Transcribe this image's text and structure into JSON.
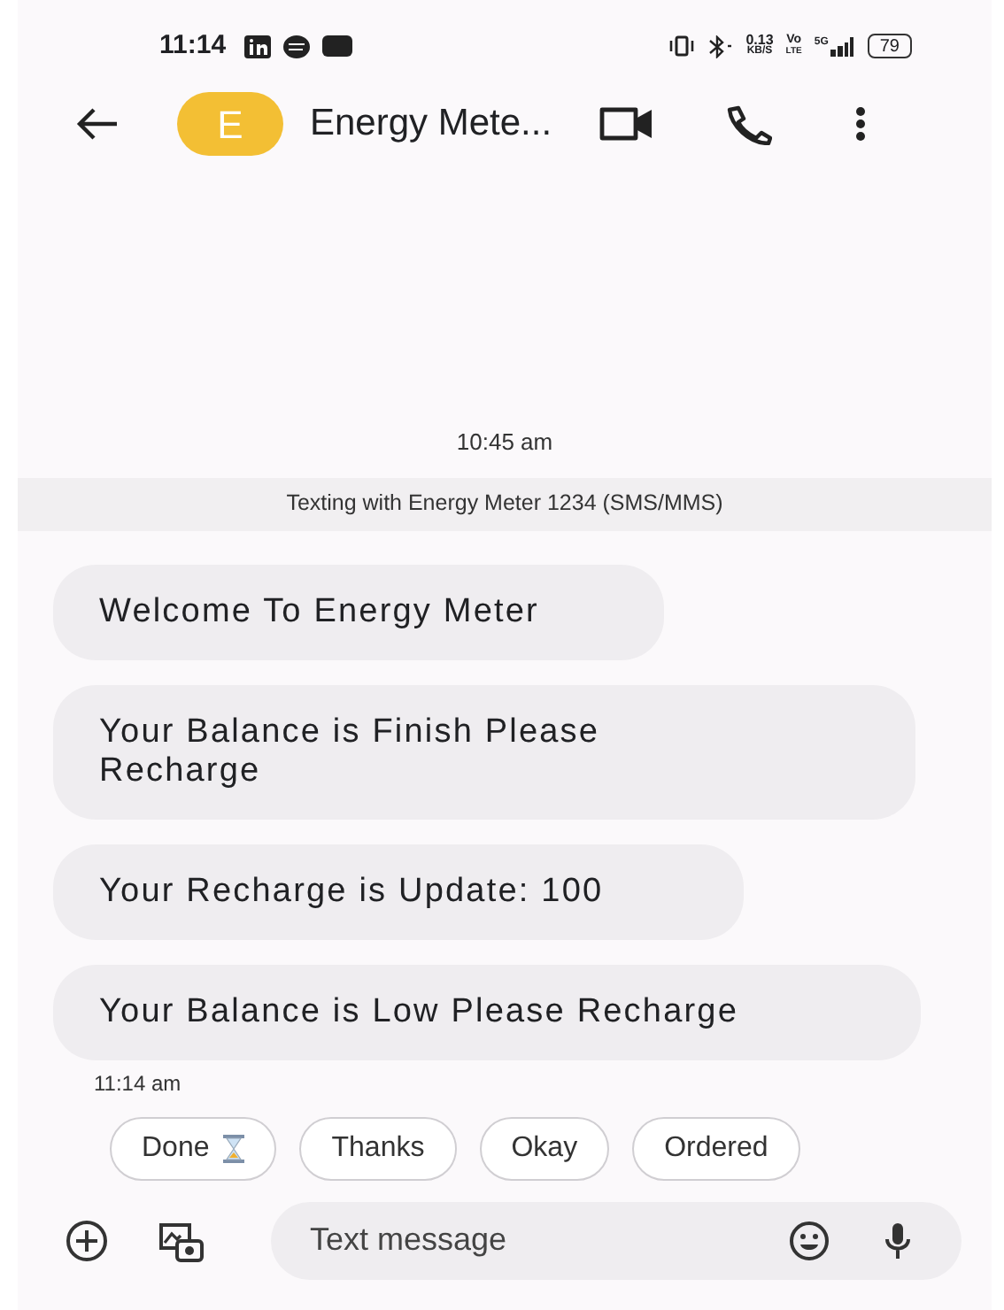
{
  "status_bar": {
    "time": "11:14",
    "speed_value": "0.13",
    "speed_unit": "KB/S",
    "volte_top": "Vo",
    "volte_bottom": "LTE",
    "network": "5G",
    "battery": "79"
  },
  "header": {
    "avatar_letter": "E",
    "title": "Energy Mete..."
  },
  "timestamp": "10:45 am",
  "banner": "Texting with Energy Meter 1234 (SMS/MMS)",
  "messages": [
    {
      "text": "Welcome To Energy Meter"
    },
    {
      "text": "Your Balance is Finish Please Recharge"
    },
    {
      "text": "Your Recharge is Update: 100"
    },
    {
      "text": "Your Balance is Low Please Recharge"
    }
  ],
  "last_time": "11:14 am",
  "replies": [
    {
      "label": "Done",
      "kind": "with_hourglass"
    },
    {
      "label": "Thanks",
      "kind": "plain"
    },
    {
      "label": "Okay",
      "kind": "plain"
    },
    {
      "label": "Ordered",
      "kind": "plain"
    }
  ],
  "composer": {
    "placeholder": "Text message"
  }
}
